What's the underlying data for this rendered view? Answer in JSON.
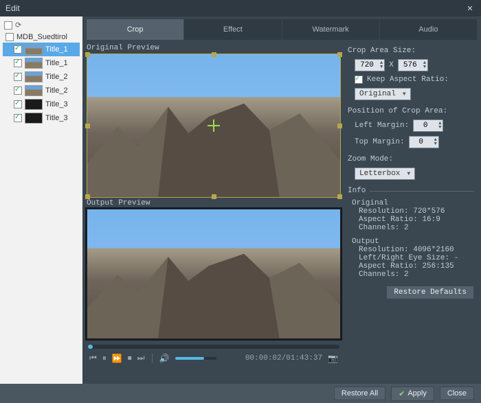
{
  "window": {
    "title": "Edit"
  },
  "sidebar": {
    "root": "MDB_Suedtirol",
    "items": [
      {
        "label": "Title_1",
        "checked": true,
        "selected": true,
        "thumb": "mt"
      },
      {
        "label": "Title_1",
        "checked": true,
        "selected": false,
        "thumb": "mt"
      },
      {
        "label": "Title_2",
        "checked": true,
        "selected": false,
        "thumb": "mt"
      },
      {
        "label": "Title_2",
        "checked": true,
        "selected": false,
        "thumb": "mt"
      },
      {
        "label": "Title_3",
        "checked": true,
        "selected": false,
        "thumb": "dark"
      },
      {
        "label": "Title_3",
        "checked": true,
        "selected": false,
        "thumb": "dark"
      }
    ]
  },
  "tabs": {
    "items": [
      "Crop",
      "Effect",
      "Watermark",
      "Audio"
    ],
    "active": 0
  },
  "previews": {
    "original_label": "Original Preview",
    "output_label": "Output Preview"
  },
  "playback": {
    "time": "00:00:02/01:43:37",
    "volume_pct": 70,
    "progress_pct": 2
  },
  "crop": {
    "size_label": "Crop Area Size:",
    "width": "720",
    "x_label": "X",
    "height": "576",
    "keep_ratio_label": "Keep Aspect Ratio:",
    "keep_ratio_checked": true,
    "ratio_preset": "Original",
    "position_label": "Position of Crop Area:",
    "left_margin_label": "Left Margin:",
    "left_margin": "0",
    "top_margin_label": "Top Margin:",
    "top_margin": "0",
    "zoom_label": "Zoom Mode:",
    "zoom_mode": "Letterbox"
  },
  "info": {
    "section_label": "Info",
    "original_label": "Original",
    "original": {
      "resolution_label": "Resolution:",
      "resolution": "720*576",
      "aspect_label": "Aspect Ratio:",
      "aspect": "16:9",
      "channels_label": "Channels:",
      "channels": "2"
    },
    "output_label": "Output",
    "output": {
      "resolution_label": "Resolution:",
      "resolution": "4096*2160",
      "lr_label": "Left/Right Eye Size:",
      "lr": "-",
      "aspect_label": "Aspect Ratio:",
      "aspect": "256:135",
      "channels_label": "Channels:",
      "channels": "2"
    },
    "restore_defaults": "Restore Defaults"
  },
  "footer": {
    "restore_all": "Restore All",
    "apply": "Apply",
    "close": "Close"
  }
}
